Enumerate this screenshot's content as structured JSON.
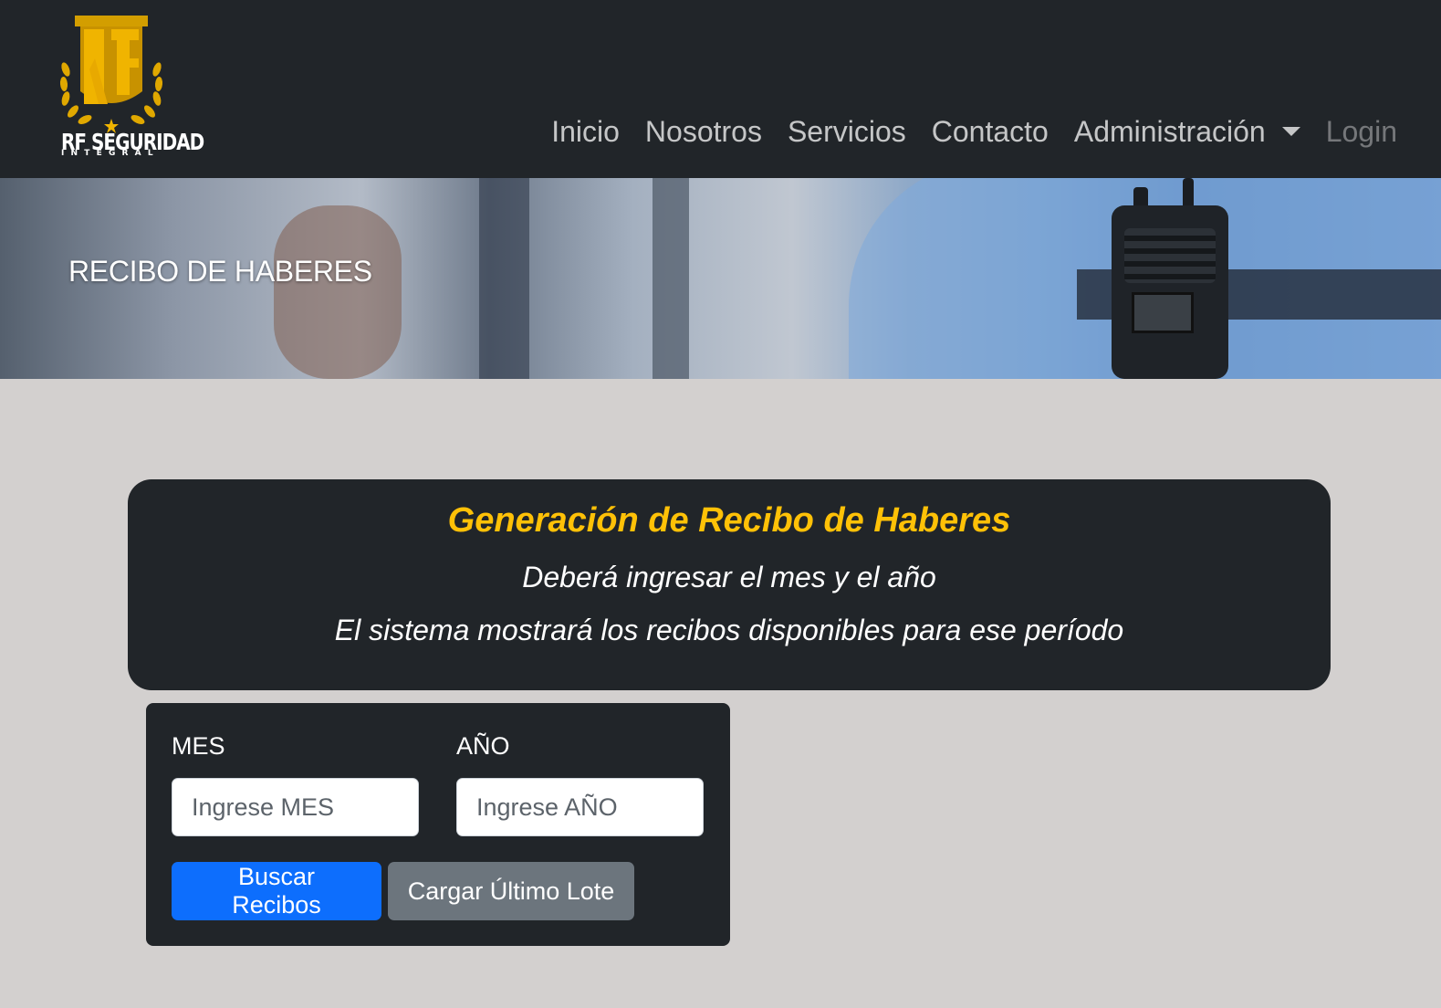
{
  "brand": {
    "logo_text": "RF SEGURIDAD",
    "logo_sub": "INTEGRAL",
    "logo_monogram": "RF"
  },
  "nav": {
    "items": [
      {
        "label": "Inicio"
      },
      {
        "label": "Nosotros"
      },
      {
        "label": "Servicios"
      },
      {
        "label": "Contacto"
      },
      {
        "label": "Administración"
      },
      {
        "label": "Login"
      }
    ]
  },
  "hero": {
    "title": "RECIBO DE HABERES"
  },
  "info": {
    "title": "Generación de Recibo de Haberes",
    "line1": "Deberá ingresar el mes y el año",
    "line2": "El sistema mostrará los recibos disponibles para ese período"
  },
  "form": {
    "mes_label": "MES",
    "mes_placeholder": "Ingrese MES",
    "mes_value": "",
    "anio_label": "AÑO",
    "anio_placeholder": "Ingrese AÑO",
    "anio_value": "",
    "search_button": "Buscar Recibos",
    "load_button": "Cargar Último Lote"
  },
  "colors": {
    "navbar_bg": "#212529",
    "accent_gold": "#ffc107",
    "primary_blue": "#0d6efd",
    "secondary_gray": "#6c757d",
    "page_bg": "#d3d0cf"
  },
  "icons": {
    "logo": "shield-laurel-logo-icon",
    "dropdown": "caret-down-icon"
  }
}
